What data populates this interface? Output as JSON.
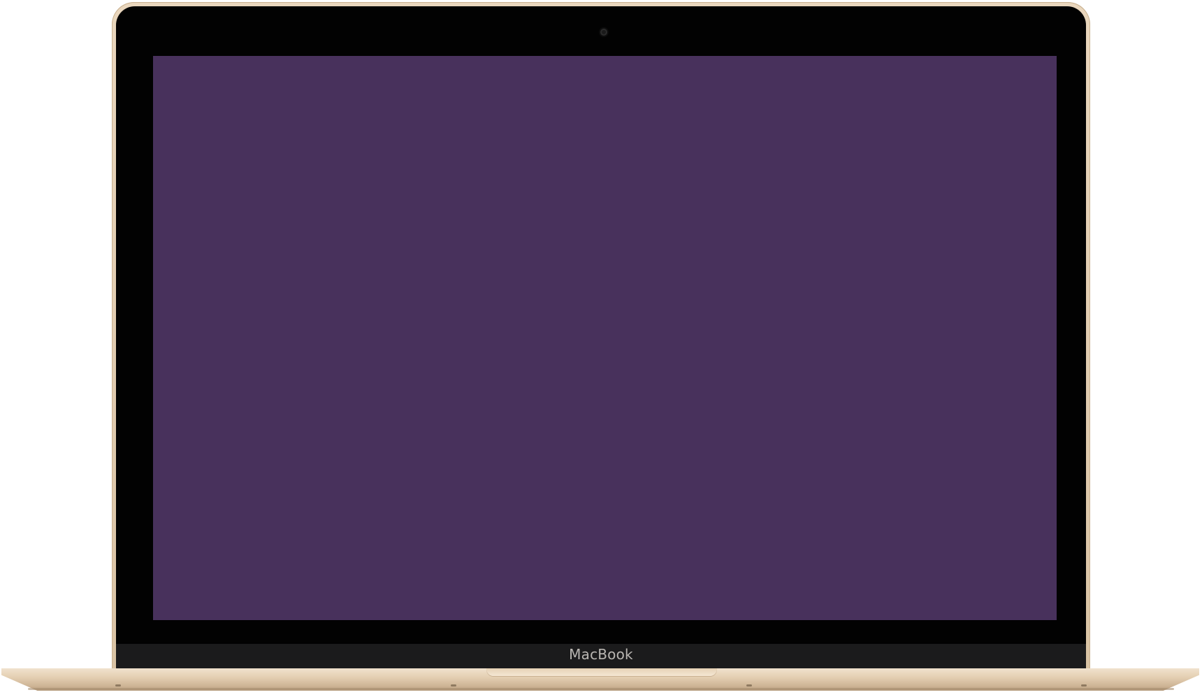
{
  "device": {
    "brand_label": "MacBook",
    "screen_color": "#48315c",
    "finish_color": "#e4cfb2",
    "bezel_color": "#020202"
  }
}
